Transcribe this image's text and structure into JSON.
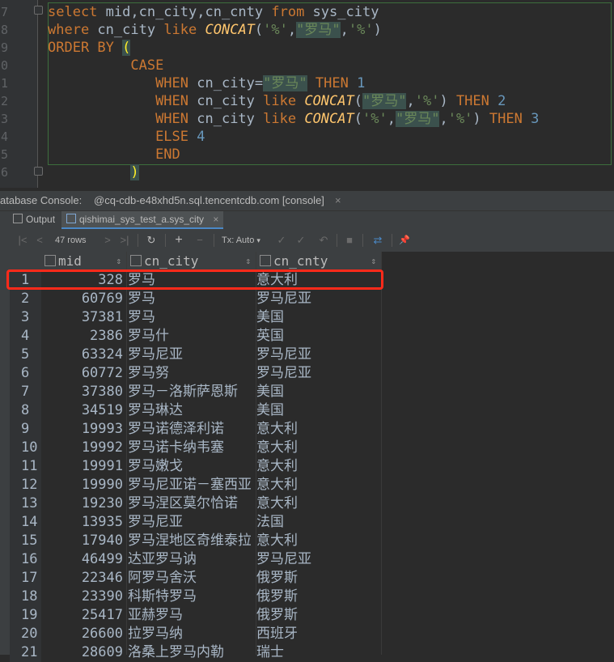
{
  "editor": {
    "lines": [
      {
        "num": "7",
        "tokens": [
          [
            "kw",
            "select "
          ],
          [
            "plain",
            "mid,cn_city,cn_cnty "
          ],
          [
            "kw",
            "from "
          ],
          [
            "plain",
            "sys_city"
          ]
        ]
      },
      {
        "num": "8",
        "tokens": [
          [
            "kw",
            "where "
          ],
          [
            "plain",
            "cn_city "
          ],
          [
            "kw",
            "like "
          ],
          [
            "fn",
            "CONCAT"
          ],
          [
            "plain",
            "("
          ],
          [
            "str",
            "'%'"
          ],
          [
            "plain",
            ","
          ],
          [
            "str-hl",
            "\"罗马\""
          ],
          [
            "plain",
            ","
          ],
          [
            "str",
            "'%'"
          ],
          [
            "plain",
            ")"
          ]
        ]
      },
      {
        "num": "9",
        "tokens": [
          [
            "kw",
            "ORDER BY "
          ],
          [
            "paren-hl",
            "("
          ]
        ]
      },
      {
        "num": "0",
        "tokens": [
          [
            "plain",
            "          "
          ],
          [
            "kw",
            "CASE"
          ]
        ]
      },
      {
        "num": "1",
        "tokens": [
          [
            "plain",
            "             "
          ],
          [
            "kw",
            "WHEN "
          ],
          [
            "plain",
            "cn_city="
          ],
          [
            "str-hl",
            "\"罗马\""
          ],
          [
            "plain",
            " "
          ],
          [
            "kw",
            "THEN "
          ],
          [
            "num",
            "1"
          ]
        ]
      },
      {
        "num": "2",
        "tokens": [
          [
            "plain",
            "             "
          ],
          [
            "kw",
            "WHEN "
          ],
          [
            "plain",
            "cn_city "
          ],
          [
            "kw",
            "like "
          ],
          [
            "fn",
            "CONCAT"
          ],
          [
            "plain",
            "("
          ],
          [
            "str-hl",
            "\"罗马\""
          ],
          [
            "plain",
            ","
          ],
          [
            "str",
            "'%'"
          ],
          [
            "plain",
            ") "
          ],
          [
            "kw",
            "THEN "
          ],
          [
            "num",
            "2"
          ]
        ]
      },
      {
        "num": "3",
        "tokens": [
          [
            "plain",
            "             "
          ],
          [
            "kw",
            "WHEN "
          ],
          [
            "plain",
            "cn_city "
          ],
          [
            "kw",
            "like "
          ],
          [
            "fn",
            "CONCAT"
          ],
          [
            "plain",
            "("
          ],
          [
            "str",
            "'%'"
          ],
          [
            "plain",
            ","
          ],
          [
            "str-hl",
            "\"罗马\""
          ],
          [
            "plain",
            ","
          ],
          [
            "str",
            "'%'"
          ],
          [
            "plain",
            ") "
          ],
          [
            "kw",
            "THEN "
          ],
          [
            "num",
            "3"
          ]
        ]
      },
      {
        "num": "4",
        "tokens": [
          [
            "plain",
            "             "
          ],
          [
            "kw",
            "ELSE "
          ],
          [
            "num",
            "4"
          ]
        ]
      },
      {
        "num": "5",
        "tokens": [
          [
            "plain",
            "             "
          ],
          [
            "kw",
            "END"
          ]
        ]
      },
      {
        "num": "6",
        "tokens": [
          [
            "plain",
            "          "
          ],
          [
            "paren-hl",
            ")"
          ]
        ]
      }
    ]
  },
  "console": {
    "title": "atabase Console:",
    "connection": "@cq-cdb-e48xhd5n.sql.tencentcdb.com [console]",
    "close": "×"
  },
  "subtabs": {
    "output": "Output",
    "result": "qishimai_sys_test_a.sys_city",
    "close": "×"
  },
  "toolbar": {
    "first": "|<",
    "prev": "<",
    "rows": "47 rows",
    "next": ">",
    "last": ">|",
    "refresh": "↻",
    "add": "+",
    "remove": "−",
    "tx": "Tx: Auto",
    "tx_arrow": "▾",
    "commit": "✓",
    "revert": "↶",
    "stop": "■",
    "compare": "⇄",
    "pin": "📌"
  },
  "grid": {
    "columns": [
      "mid",
      "cn_city",
      "cn_cnty"
    ],
    "rows": [
      [
        "1",
        "328",
        "罗马",
        "意大利"
      ],
      [
        "2",
        "60769",
        "罗马",
        "罗马尼亚"
      ],
      [
        "3",
        "37381",
        "罗马",
        "美国"
      ],
      [
        "4",
        "2386",
        "罗马什",
        "英国"
      ],
      [
        "5",
        "63324",
        "罗马尼亚",
        "罗马尼亚"
      ],
      [
        "6",
        "60772",
        "罗马努",
        "罗马尼亚"
      ],
      [
        "7",
        "37380",
        "罗马－洛斯萨恩斯",
        "美国"
      ],
      [
        "8",
        "34519",
        "罗马琳达",
        "美国"
      ],
      [
        "9",
        "19993",
        "罗马诺德泽利诺",
        "意大利"
      ],
      [
        "10",
        "19992",
        "罗马诺卡纳韦塞",
        "意大利"
      ],
      [
        "11",
        "19991",
        "罗马嫩戈",
        "意大利"
      ],
      [
        "12",
        "19990",
        "罗马尼亚诺－塞西亚",
        "意大利"
      ],
      [
        "13",
        "19230",
        "罗马涅区莫尔恰诺",
        "意大利"
      ],
      [
        "14",
        "13935",
        "罗马尼亚",
        "法国"
      ],
      [
        "15",
        "17940",
        "罗马涅地区奇维泰拉",
        "意大利"
      ],
      [
        "16",
        "46499",
        "达亚罗马讷",
        "罗马尼亚"
      ],
      [
        "17",
        "22346",
        "阿罗马舍沃",
        "俄罗斯"
      ],
      [
        "18",
        "23390",
        "科斯特罗马",
        "俄罗斯"
      ],
      [
        "19",
        "25417",
        "亚赫罗马",
        "俄罗斯"
      ],
      [
        "20",
        "26600",
        "拉罗马纳",
        "西班牙"
      ],
      [
        "21",
        "28609",
        "洛桑上罗马内勒",
        "瑞士"
      ]
    ]
  }
}
